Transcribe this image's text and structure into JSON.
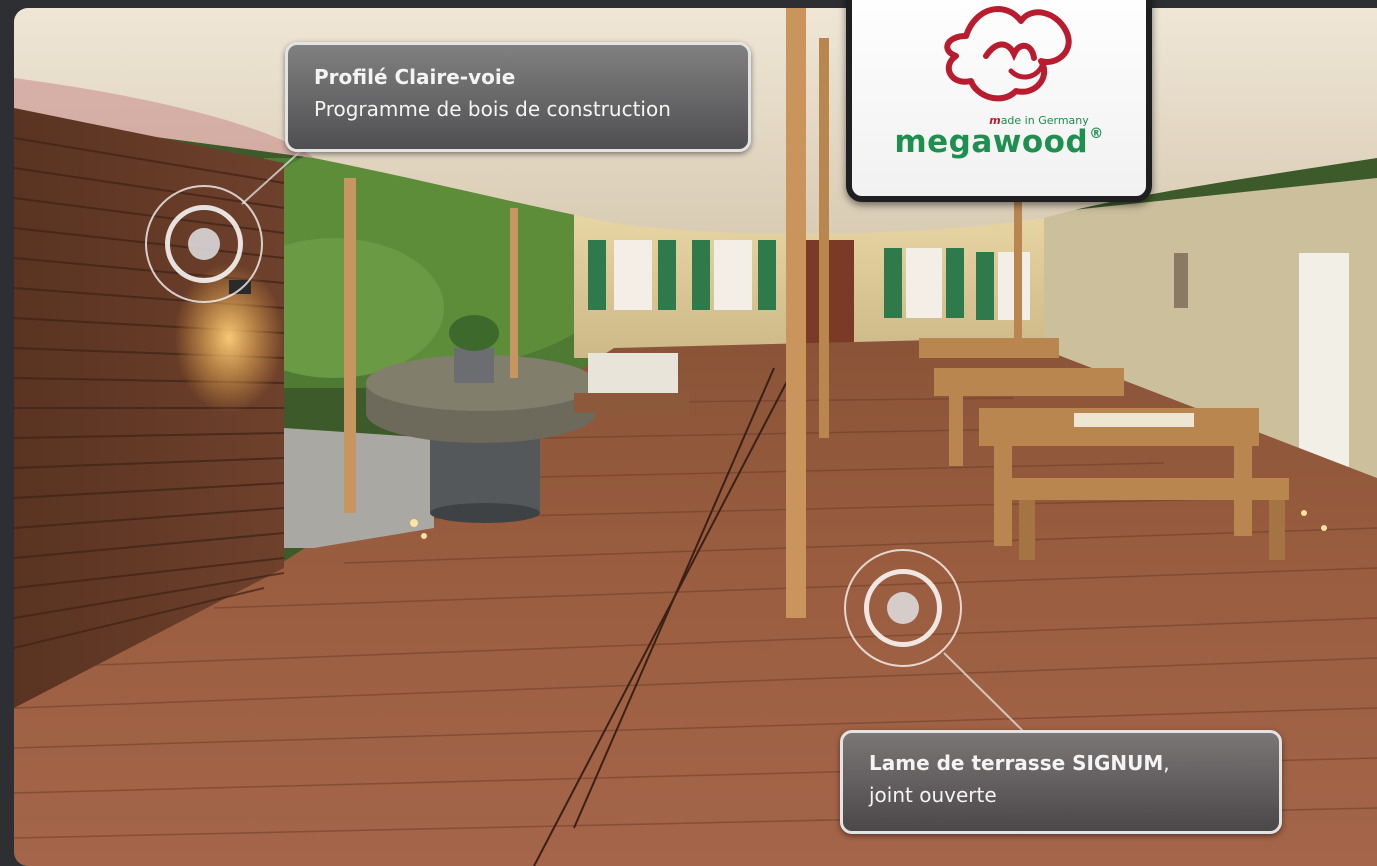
{
  "hotspots": [
    {
      "title": "Profilé Claire-voie",
      "subtitle": "Programme de bois de construction"
    },
    {
      "title": "Lame de terrasse SIGNUM",
      "title_suffix": ",",
      "subtitle": "joint ouverte"
    }
  ],
  "logo": {
    "tagline_mark": "m",
    "tagline_rest": "ade in Germany",
    "brand": "megawood",
    "registered": "®"
  },
  "colors": {
    "brand_green": "#1e8f4e",
    "brand_red": "#b81c2e",
    "callout_border": "#e3e3e3",
    "frame": "#2e2f33"
  },
  "icons": [
    "hotspot-marker-icon",
    "megawood-logo-mark-icon"
  ]
}
